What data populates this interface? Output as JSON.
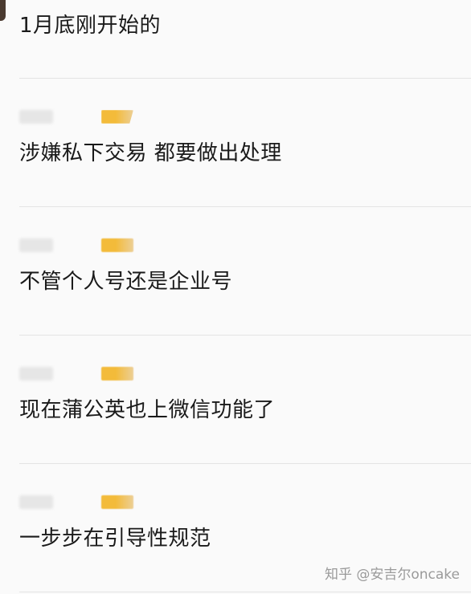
{
  "comments": [
    {
      "text": "1月底刚开始的"
    },
    {
      "text": "涉嫌私下交易 都要做出处理"
    },
    {
      "text": "不管个人号还是企业号"
    },
    {
      "text": "现在蒲公英也上微信功能了"
    },
    {
      "text": "一步步在引导性规范"
    }
  ],
  "watermark": "知乎 @安吉尔oncake",
  "colors": {
    "background": "#fafafa",
    "badge_gold": "#f3bb3a",
    "divider": "#e4e4e4"
  }
}
